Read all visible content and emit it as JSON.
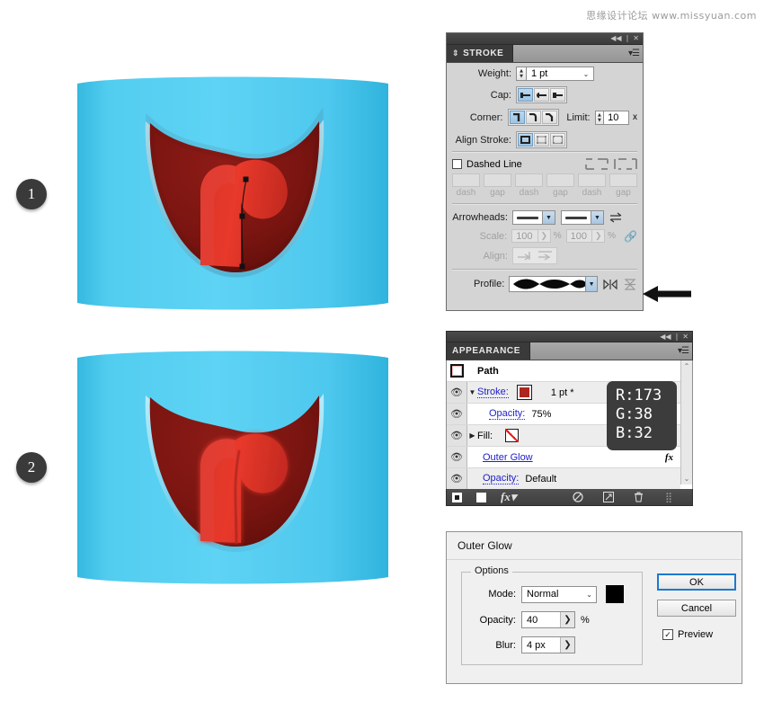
{
  "watermark": "思缘设计论坛  www.missyuan.com",
  "steps": [
    {
      "label": "1"
    },
    {
      "label": "2"
    }
  ],
  "stroke_panel": {
    "tab_label": "STROKE",
    "weight": {
      "label": "Weight:",
      "value": "1 pt"
    },
    "cap": {
      "label": "Cap:",
      "options": [
        "butt-cap",
        "round-cap",
        "projecting-cap"
      ],
      "selected": 0
    },
    "corner": {
      "label": "Corner:",
      "options": [
        "miter-join",
        "round-join",
        "bevel-join"
      ],
      "selected": 0
    },
    "limit": {
      "label": "Limit:",
      "value": "10",
      "unit": "x"
    },
    "align_stroke": {
      "label": "Align Stroke:",
      "options": [
        "align-center",
        "align-inside",
        "align-outside"
      ],
      "selected": 0
    },
    "dashed_line": {
      "label": "Dashed Line",
      "checked": false
    },
    "dash_fields": [
      "",
      "",
      "",
      "",
      "",
      ""
    ],
    "dash_labels": [
      "dash",
      "gap",
      "dash",
      "gap",
      "dash",
      "gap"
    ],
    "arrowheads": {
      "label": "Arrowheads:",
      "start": "none",
      "end": "none"
    },
    "scale": {
      "label": "Scale:",
      "start": "100",
      "end": "100",
      "unit": "%"
    },
    "align": {
      "label": "Align:",
      "options": [
        "extend-beyond-end",
        "place-at-end"
      ]
    },
    "profile": {
      "label": "Profile:",
      "value": "Width Profile 4"
    }
  },
  "appearance_panel": {
    "tab_label": "APPEARANCE",
    "object_label": "Path",
    "rows": [
      {
        "name": "Stroke:",
        "value": "1 pt *",
        "kind": "stroke"
      },
      {
        "name": "Opacity:",
        "value": "75%",
        "kind": "opacity-nested"
      },
      {
        "name": "Fill:",
        "value": "",
        "kind": "fill"
      },
      {
        "name": "Outer Glow",
        "value": "",
        "kind": "effect"
      },
      {
        "name": "Opacity:",
        "value": "Default",
        "kind": "opacity"
      }
    ],
    "footer_icons": [
      "add-new-stroke",
      "add-new-fill",
      "add-new-effect",
      "clear-appearance",
      "duplicate-item",
      "delete-item"
    ]
  },
  "rgb_tooltip": {
    "r": "R:173",
    "g": "G:38",
    "b": "B:32"
  },
  "glow_dialog": {
    "title": "Outer Glow",
    "options_legend": "Options",
    "mode": {
      "label": "Mode:",
      "value": "Normal"
    },
    "color": "#000000",
    "opacity": {
      "label": "Opacity:",
      "value": "40",
      "unit": "%"
    },
    "blur": {
      "label": "Blur:",
      "value": "4 px"
    },
    "ok": "OK",
    "cancel": "Cancel",
    "preview": {
      "label": "Preview",
      "checked": true
    }
  },
  "colors": {
    "skin": "#4ecbef",
    "mouth_dark": "#7c1612",
    "tongue": "#e8372a",
    "stroke_red": "#ad2620",
    "badge": "#3a3a3a",
    "link": "#2020cc"
  }
}
